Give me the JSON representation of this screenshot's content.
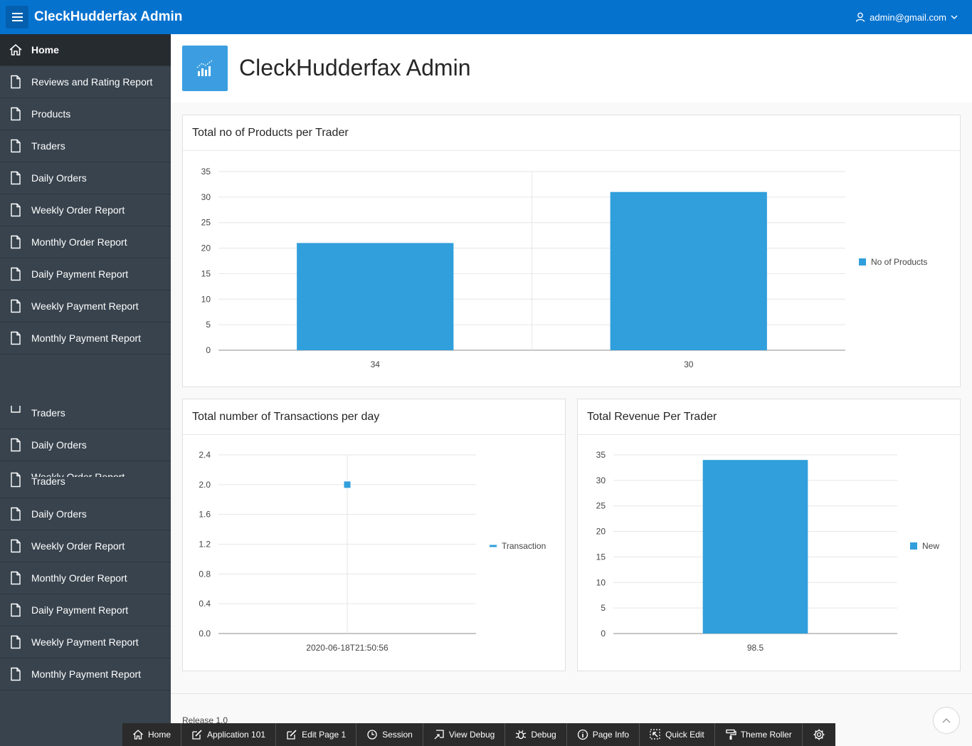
{
  "header": {
    "app_title": "CleckHudderfax Admin",
    "user": "admin@gmail.com"
  },
  "sidebar": {
    "items": [
      "Home",
      "Reviews and Rating Report",
      "Products",
      "Traders",
      "Daily Orders",
      "Weekly Order Report",
      "Monthly Order Report",
      "Daily Payment Report",
      "Weekly Payment Report",
      "Monthly Payment Report",
      "Traders",
      "Daily Orders",
      "Weekly Order Report",
      "Traders",
      "Daily Orders",
      "Weekly Order Report",
      "Monthly Order Report",
      "Daily Payment Report",
      "Weekly Payment Report",
      "Monthly Payment Report"
    ]
  },
  "page": {
    "title": "CleckHudderfax Admin",
    "release": "Release 1.0"
  },
  "chart_data": [
    {
      "type": "bar",
      "title": "Total no of Products per Trader",
      "categories": [
        "34",
        "30"
      ],
      "series": [
        {
          "name": "No of Products",
          "values": [
            21,
            31
          ]
        }
      ],
      "yticks": [
        "0",
        "5",
        "10",
        "15",
        "20",
        "25",
        "30",
        "35"
      ],
      "ylim": [
        0,
        35
      ],
      "color": "#309fdb",
      "legend": "right"
    },
    {
      "type": "scatter",
      "title": "Total number of Transactions per day",
      "categories": [
        "2020-06-18T21:50:56"
      ],
      "series": [
        {
          "name": "Transaction",
          "values": [
            2
          ]
        }
      ],
      "yticks": [
        "0.0",
        "0.4",
        "0.8",
        "1.2",
        "1.6",
        "2.0",
        "2.4"
      ],
      "ylim": [
        0,
        2.4
      ],
      "color": "#309fdb",
      "legend": "right"
    },
    {
      "type": "bar",
      "title": "Total Revenue Per Trader",
      "categories": [
        "98.5"
      ],
      "series": [
        {
          "name": "New",
          "values": [
            34
          ]
        }
      ],
      "yticks": [
        "0",
        "5",
        "10",
        "15",
        "20",
        "25",
        "30",
        "35"
      ],
      "ylim": [
        0,
        35
      ],
      "color": "#309fdb",
      "legend": "right"
    }
  ],
  "devbar": {
    "items": [
      "Home",
      "Application 101",
      "Edit Page 1",
      "Session",
      "View Debug",
      "Debug",
      "Page Info",
      "Quick Edit",
      "Theme Roller"
    ]
  }
}
